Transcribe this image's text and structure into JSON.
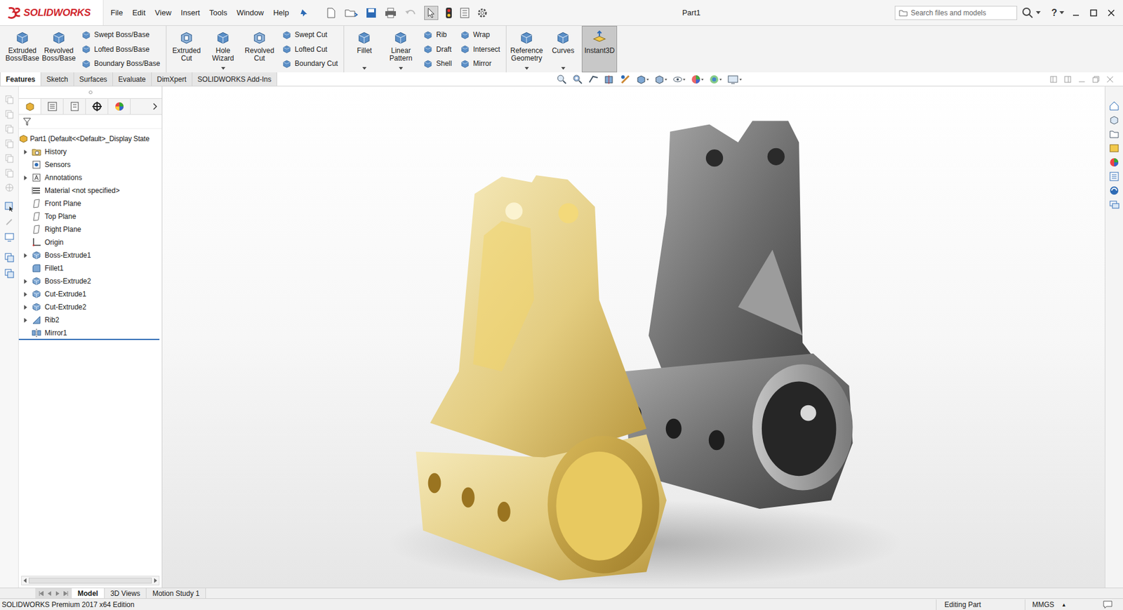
{
  "app": {
    "logo": "SOLIDWORKS"
  },
  "window": {
    "title": "Part1"
  },
  "menu": [
    "File",
    "Edit",
    "View",
    "Insert",
    "Tools",
    "Window",
    "Help"
  ],
  "search": {
    "placeholder": "Search files and models"
  },
  "help": "?",
  "ribbon": [
    {
      "items": [
        {
          "kind": "large",
          "label": "Extruded Boss/Base",
          "dropdown": false,
          "selected": false
        },
        {
          "kind": "large",
          "label": "Revolved Boss/Base",
          "dropdown": false,
          "selected": false
        },
        {
          "kind": "stack",
          "items": [
            {
              "label": "Swept Boss/Base"
            },
            {
              "label": "Lofted Boss/Base"
            },
            {
              "label": "Boundary Boss/Base"
            }
          ]
        }
      ]
    },
    {
      "items": [
        {
          "kind": "large",
          "label": "Extruded Cut",
          "dropdown": false,
          "selected": false
        },
        {
          "kind": "large",
          "label": "Hole Wizard",
          "dropdown": true,
          "selected": false
        },
        {
          "kind": "large",
          "label": "Revolved Cut",
          "dropdown": false,
          "selected": false
        },
        {
          "kind": "stack",
          "items": [
            {
              "label": "Swept Cut"
            },
            {
              "label": "Lofted Cut"
            },
            {
              "label": "Boundary Cut"
            }
          ]
        }
      ]
    },
    {
      "items": [
        {
          "kind": "large",
          "label": "Fillet",
          "dropdown": true,
          "selected": false
        },
        {
          "kind": "large",
          "label": "Linear Pattern",
          "dropdown": true,
          "selected": false
        },
        {
          "kind": "stack",
          "items": [
            {
              "label": "Rib"
            },
            {
              "label": "Draft"
            },
            {
              "label": "Shell"
            }
          ]
        },
        {
          "kind": "stack",
          "items": [
            {
              "label": "Wrap"
            },
            {
              "label": "Intersect"
            },
            {
              "label": "Mirror"
            }
          ]
        }
      ]
    },
    {
      "items": [
        {
          "kind": "large",
          "label": "Reference Geometry",
          "dropdown": true,
          "selected": false
        },
        {
          "kind": "large",
          "label": "Curves",
          "dropdown": true,
          "selected": false
        },
        {
          "kind": "large",
          "label": "Instant3D",
          "dropdown": false,
          "selected": true
        }
      ]
    }
  ],
  "command_tabs": [
    {
      "label": "Features",
      "selected": true
    },
    {
      "label": "Sketch",
      "selected": false
    },
    {
      "label": "Surfaces",
      "selected": false
    },
    {
      "label": "Evaluate",
      "selected": false
    },
    {
      "label": "DimXpert",
      "selected": false
    },
    {
      "label": "SOLIDWORKS Add-Ins",
      "selected": false
    }
  ],
  "tree": {
    "root": "Part1  (Default<<Default>_Display State",
    "items": [
      {
        "label": "History",
        "kind": "folder",
        "has_children": true,
        "expanded": false
      },
      {
        "label": "Sensors",
        "kind": "sensor",
        "has_children": false,
        "expanded": false
      },
      {
        "label": "Annotations",
        "kind": "annotation",
        "has_children": true,
        "expanded": false
      },
      {
        "label": "Material <not specified>",
        "kind": "material",
        "has_children": false,
        "expanded": false
      },
      {
        "label": "Front Plane",
        "kind": "plane",
        "has_children": false,
        "expanded": false
      },
      {
        "label": "Top Plane",
        "kind": "plane",
        "has_children": false,
        "expanded": false
      },
      {
        "label": "Right Plane",
        "kind": "plane",
        "has_children": false,
        "expanded": false
      },
      {
        "label": "Origin",
        "kind": "origin",
        "has_children": false,
        "expanded": false
      },
      {
        "label": "Boss-Extrude1",
        "kind": "feature",
        "has_children": true,
        "expanded": false
      },
      {
        "label": "Fillet1",
        "kind": "fillet",
        "has_children": false,
        "expanded": false
      },
      {
        "label": "Boss-Extrude2",
        "kind": "feature",
        "has_children": true,
        "expanded": false
      },
      {
        "label": "Cut-Extrude1",
        "kind": "feature",
        "has_children": true,
        "expanded": false
      },
      {
        "label": "Cut-Extrude2",
        "kind": "feature",
        "has_children": true,
        "expanded": false
      },
      {
        "label": "Rib2",
        "kind": "rib",
        "has_children": true,
        "expanded": false
      },
      {
        "label": "Mirror1",
        "kind": "mirror",
        "has_children": false,
        "expanded": false
      }
    ]
  },
  "bottom_tabs": [
    {
      "label": "Model",
      "selected": true
    },
    {
      "label": "3D Views",
      "selected": false
    },
    {
      "label": "Motion Study 1",
      "selected": false
    }
  ],
  "status": {
    "edition": "SOLIDWORKS Premium 2017 x64 Edition",
    "mode": "Editing Part",
    "units": "MMGS",
    "units_arrow": "▴"
  }
}
